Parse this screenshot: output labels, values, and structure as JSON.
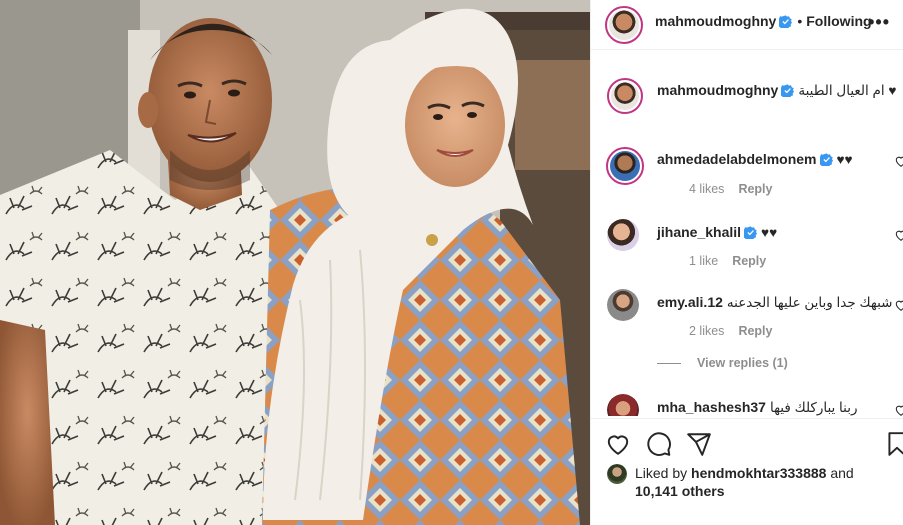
{
  "post": {
    "author": "mahmoudmoghny",
    "follow_state": "Following",
    "more_label": "•••"
  },
  "comments": [
    {
      "username": "mahmoudmoghny",
      "text": "ام العيال الطيبة ♥",
      "time": "",
      "likes": "",
      "reply": "",
      "verified": true
    },
    {
      "username": "ahmedadelabdelmonem",
      "text": "♥♥",
      "time": "",
      "likes": "4 likes",
      "reply": "Reply",
      "verified": true
    },
    {
      "username": "jihane_khalil",
      "text": "♥♥",
      "time": "",
      "likes": "1 like",
      "reply": "Reply",
      "verified": true
    },
    {
      "username": "emy.ali.12",
      "text": "شبهك جدا وباين عليها الجدعنه",
      "time": "",
      "likes": "2 likes",
      "reply": "Reply",
      "verified": false
    },
    {
      "username": "mha_hashesh37",
      "text": "ربنا يباركلك فيها",
      "time": "",
      "likes": "",
      "reply": "",
      "verified": false
    }
  ],
  "view_replies": "View replies (1)",
  "likes_summary": {
    "prefix": "Liked by ",
    "user": "hendmokhtar333888",
    "middle": " and",
    "count": "10,141 others"
  },
  "colors": {
    "verified_blue": "#3897f0",
    "story_ring": "#c13584",
    "muted_text": "#8e8e8e"
  },
  "icons": {
    "header_verified": "verified-badge-icon",
    "comment_like": "heart-outline-icon",
    "like": "heart-outline-icon",
    "comment": "speech-bubble-icon",
    "share": "paper-plane-icon",
    "save": "bookmark-icon"
  }
}
